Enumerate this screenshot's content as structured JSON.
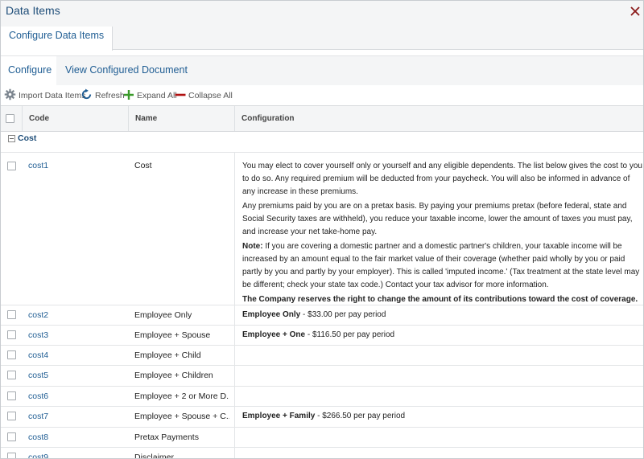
{
  "window": {
    "title": "Data Items"
  },
  "top_tab": {
    "label": "Configure Data Items"
  },
  "sub_tabs": [
    {
      "label": "Configure"
    },
    {
      "label": "View Configured Document"
    }
  ],
  "toolbar": {
    "import_label": "Import Data Items",
    "refresh_label": "Refresh",
    "expand_label": "Expand All",
    "collapse_label": "Collapse All"
  },
  "table": {
    "headers": {
      "code": "Code",
      "name": "Name",
      "configuration": "Configuration"
    },
    "group": {
      "label": "Cost"
    },
    "rows": [
      {
        "code": "cost1",
        "name": "Cost"
      },
      {
        "code": "cost2",
        "name": "Employee Only",
        "conf_bold": "Employee Only",
        "conf_rest": " - $33.00 per pay period"
      },
      {
        "code": "cost3",
        "name": "Employee + Spouse",
        "conf_bold": "Employee + One",
        "conf_rest": " - $116.50 per pay period"
      },
      {
        "code": "cost4",
        "name": "Employee + Child"
      },
      {
        "code": "cost5",
        "name": "Employee + Children"
      },
      {
        "code": "cost6",
        "name": "Employee + 2 or More D..."
      },
      {
        "code": "cost7",
        "name": "Employee + Spouse + C...",
        "conf_bold": "Employee + Family",
        "conf_rest": " - $266.50 per pay period"
      },
      {
        "code": "cost8",
        "name": "Pretax Payments"
      },
      {
        "code": "cost9",
        "name": "Disclaimer"
      }
    ],
    "cost1_config": {
      "p1": "You may elect to cover yourself only or yourself and any eligible dependents. The list below gives the cost to you to do so. Any required premium will be deducted from your paycheck. You will also be informed in advance of any increase in these premiums.",
      "p2": "Any premiums paid by you are on a pretax basis. By paying your premiums pretax (before federal, state and Social Security taxes are withheld), you reduce your taxable income, lower the amount of taxes you must pay, and increase your net take-home pay.",
      "p3_bold": "Note:",
      "p3": " If you are covering a domestic partner and a domestic partner's children, your taxable income will be increased by an amount equal to the fair market value of their coverage (whether paid wholly by you or paid partly by you and partly by your employer). This is called 'imputed income.' (Tax treatment at the state level may be different; check your state tax code.) Contact your tax advisor for more information.",
      "p4": "The Company reserves the right to change the amount of its contributions toward the cost of coverage."
    }
  },
  "colors": {
    "link": "#1f5d93",
    "close": "#8b1a1a",
    "expand": "#3a9a2a",
    "collapse": "#b01010"
  }
}
